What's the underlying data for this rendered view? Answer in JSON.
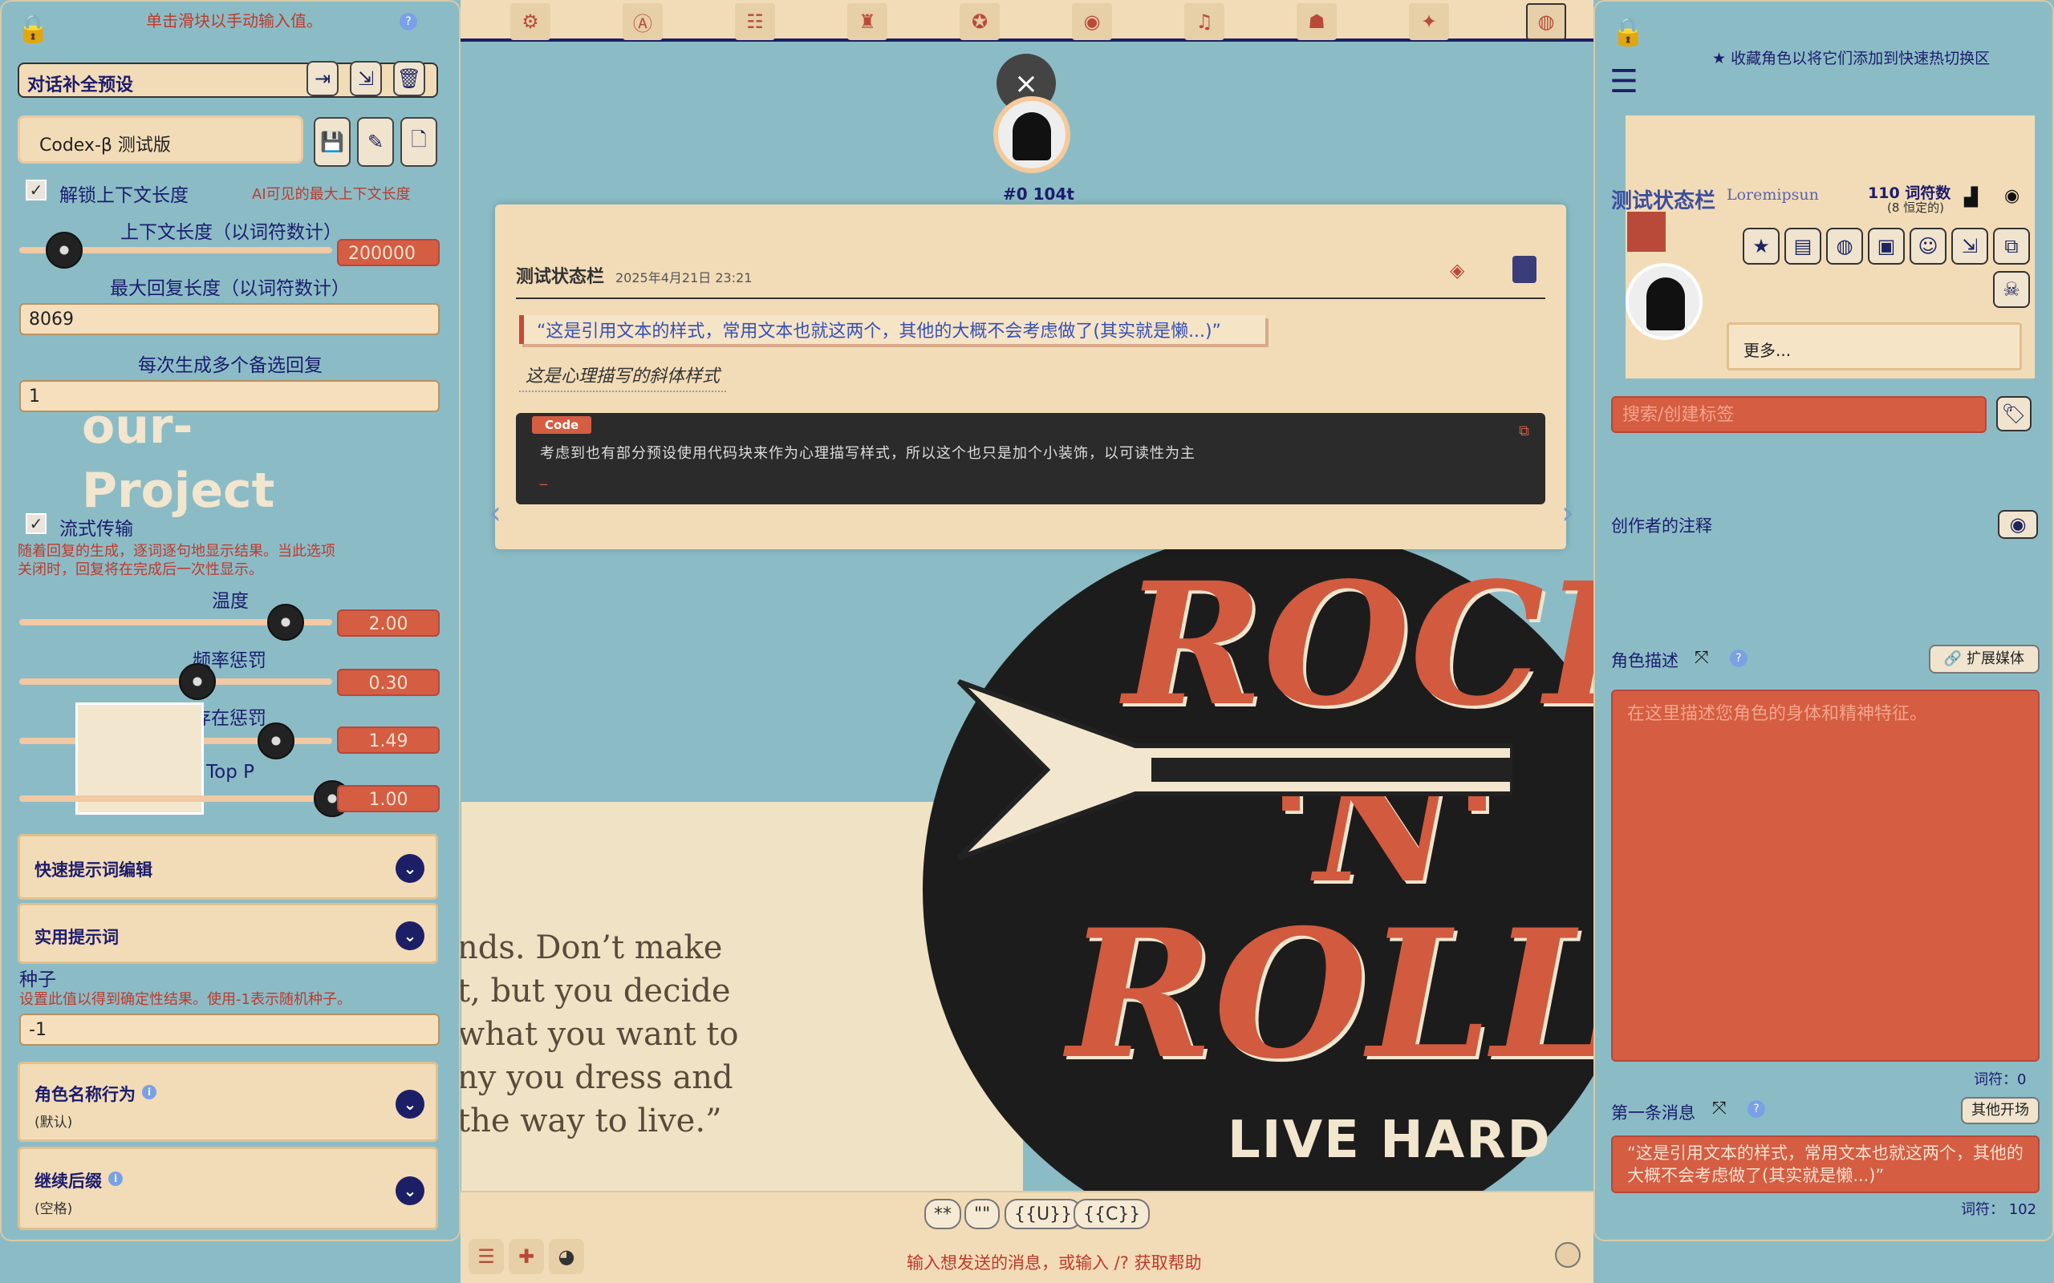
{
  "left": {
    "hint": "单击滑块以手动输入值。",
    "preset_label": "对话补全预设",
    "model_name": "Codex-β 测试版",
    "unlock_context_label": "解锁上下文长度",
    "unlock_context_note": "AI可见的最大上下文长度",
    "context_length_label": "上下文长度（以词符数计）",
    "context_length_value": "200000",
    "max_reply_label": "最大回复长度（以词符数计）",
    "max_reply_value": "8069",
    "multi_reply_label": "每次生成多个备选回复",
    "multi_reply_value": "1",
    "stream_label": "流式传输",
    "stream_note": "随着回复的生成，逐词逐句地显示结果。当此选项关闭时，回复将在完成后一次性显示。",
    "temperature_label": "温度",
    "temperature_value": "2.00",
    "temperature_fraction": 0.85,
    "freq_label": "频率惩罚",
    "freq_value": "0.30",
    "freq_fraction": 0.57,
    "presence_label": "存在惩罚",
    "presence_value": "1.49",
    "presence_fraction": 0.82,
    "top_p_label": "Top P",
    "top_p_value": "1.00",
    "top_p_fraction": 1.0,
    "quick_edit_label": "快速提示词编辑",
    "utility_label": "实用提示词",
    "seed_label": "种子",
    "seed_note": "设置此值以得到确定性结果。使用-1表示随机种子。",
    "seed_value": "-1",
    "char_name_label": "角色名称行为",
    "char_name_sub": "(默认)",
    "continue_label": "继续后缀",
    "continue_sub": "(空格)"
  },
  "chat": {
    "close_icon": "×",
    "avatar_meta": "#0 104t",
    "author": "测试状态栏",
    "date": "2025年4月21日 23:21",
    "quote": "“这是引用文本的样式，常用文本也就这两个，其他的大概不会考虑做了(其实就是懒...)”",
    "italic": "这是心理描写的斜体样式",
    "code_tag": "Code",
    "code_text": "考虑到也有部分预设使用代码块来作为心理描写样式，所以这个也只是加个小装饰，以可读性为主",
    "code_cursor": "_",
    "quick_replies": [
      "**",
      "\"\"",
      "{{U}}",
      "{{C}}"
    ],
    "input_placeholder": "输入想发送的消息，或输入 /? 获取帮助"
  },
  "background": {
    "rock": "ROCK",
    "n": "'N'",
    "roll": "ROLL",
    "livehard": "LIVE HARD",
    "quote_lines": [
      "nds. Don’t make",
      "t, but you decide",
      "what you want to",
      "ny you dress and",
      "the way to live.”"
    ],
    "project_word1": "our-",
    "project_word2": "Project"
  },
  "right": {
    "fav_note": "收藏角色以将它们添加到快速热切换区",
    "char_name": "测试状态栏",
    "lorem": "Loremipsun",
    "token_count": "110 词符数",
    "token_fixed": "(8 恒定的)",
    "more_label": "更多...",
    "tag_placeholder": "搜索/创建标签",
    "creator_notes": "创作者的注释",
    "desc_label": "角色描述",
    "expand_media": "扩展媒体",
    "desc_placeholder": "在这里描述您角色的身体和精神特征。",
    "desc_tokens": "词符：0",
    "first_msg_label": "第一条消息",
    "other_openings": "其他开场",
    "first_msg": "“这是引用文本的样式，常用文本也就这两个，其他的大概不会考虑做了(其实就是懒...)”",
    "first_msg_tokens": "词符：  102"
  }
}
